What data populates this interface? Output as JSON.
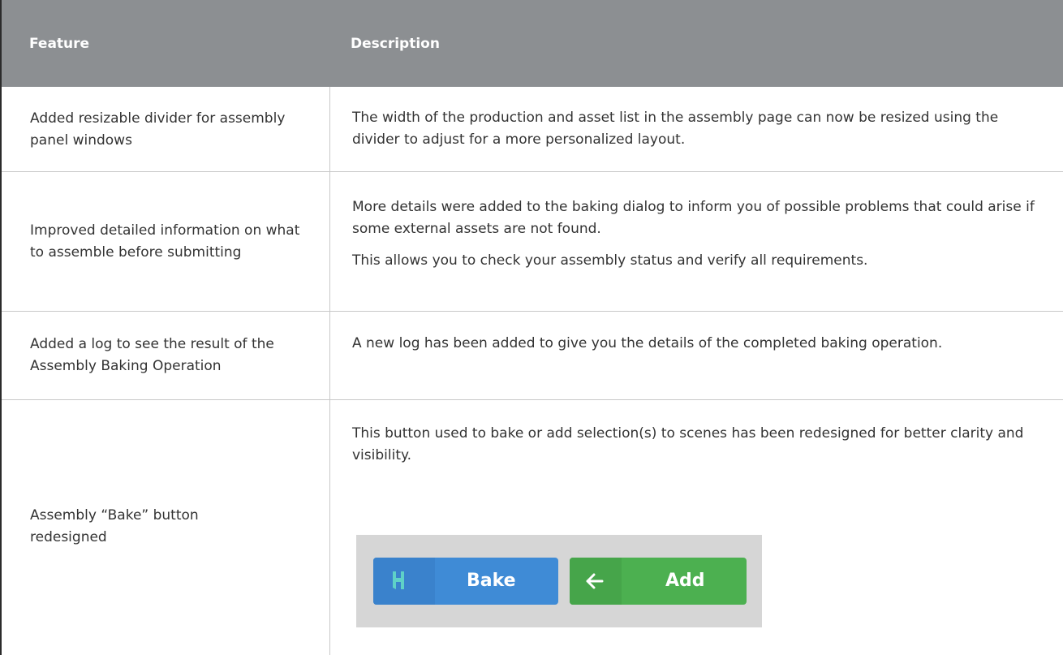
{
  "header": {
    "col_feature": "Feature",
    "col_description": "Description"
  },
  "rows": [
    {
      "feature": "Added resizable divider for assembly panel windows",
      "description": [
        "The width of the production and asset list in the assembly page can now be resized using the divider to adjust for a more personalized layout."
      ]
    },
    {
      "feature": "Improved detailed information on what to assemble before submitting",
      "description": [
        "More details were added to the baking dialog to inform you of possible problems that could arise if some external assets are not found.",
        "This allows you to check your assembly status and verify all requirements."
      ]
    },
    {
      "feature": "Added a log to see the result of the Assembly Baking Operation",
      "description": [
        "A new log has been added to give you the details of the completed baking operation."
      ]
    },
    {
      "feature": "Assembly “Bake” button redesigned",
      "description": [
        "This button used to bake or add selection(s) to scenes has been redesigned for better clarity and visibility."
      ]
    }
  ],
  "buttons": {
    "bake_label": "Bake",
    "add_label": "Add",
    "bake_icon": "harmony-h-icon",
    "add_icon": "arrow-left-icon",
    "bake_color": "#3f8bd6",
    "add_color": "#4cb050"
  }
}
